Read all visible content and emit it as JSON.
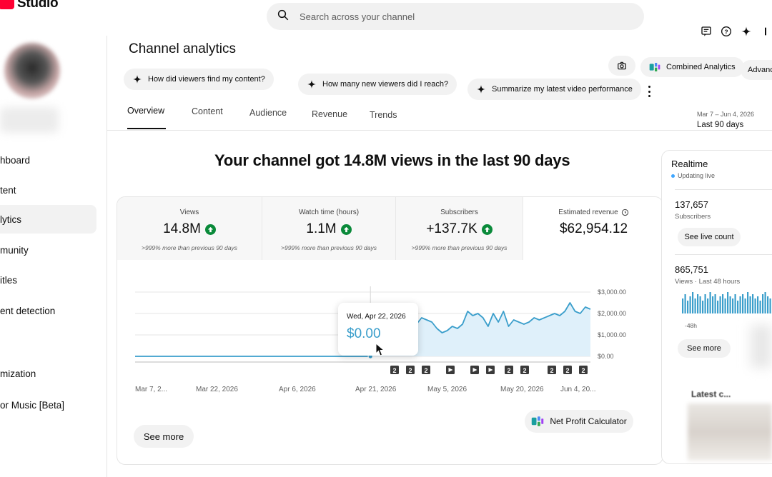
{
  "app": {
    "logo_text": "Studio"
  },
  "search": {
    "placeholder": "Search across your channel"
  },
  "sidebar": {
    "items": [
      {
        "label": "hboard"
      },
      {
        "label": "tent"
      },
      {
        "label": "lytics"
      },
      {
        "label": "munity"
      },
      {
        "label": "itles"
      },
      {
        "label": "ent detection"
      },
      {
        "label": "mization"
      },
      {
        "label": "or Music [Beta]"
      }
    ]
  },
  "header": {
    "title": "Channel analytics",
    "suggestions": [
      "How did viewers find my content?",
      "How many new viewers did I reach?",
      "Summarize my latest video performance"
    ],
    "combined_analytics": "Combined Analytics",
    "advanced": "Advanc"
  },
  "tabs": [
    "Overview",
    "Content",
    "Audience",
    "Revenue",
    "Trends"
  ],
  "date_range": {
    "range": "Mar 7 – Jun 4, 2026",
    "label": "Last 90 days"
  },
  "headline": "Your channel got 14.8M views in the last 90 days",
  "metrics": [
    {
      "label": "Views",
      "value": "14.8M",
      "sub": ">999% more than previous 90 days",
      "trend": "up"
    },
    {
      "label": "Watch time (hours)",
      "value": "1.1M",
      "sub": ">999% more than previous 90 days",
      "trend": "up"
    },
    {
      "label": "Subscribers",
      "value": "+137.7K",
      "sub": ">999% more than previous 90 days",
      "trend": "up"
    },
    {
      "label": "Estimated revenue",
      "value": "$62,954.12",
      "sub": "",
      "trend": "none"
    }
  ],
  "tooltip": {
    "date": "Wed, Apr 22, 2026",
    "value": "$0.00"
  },
  "chart_data": {
    "type": "line",
    "title": "",
    "xlabel": "",
    "ylabel": "",
    "x_tick_labels": [
      "Mar 7, 2...",
      "Mar 22, 2026",
      "Apr 6, 2026",
      "Apr 21, 2026",
      "May 5, 2026",
      "May 20, 2026",
      "Jun 4, 20..."
    ],
    "y_tick_labels": [
      "$3,000.00",
      "$2,000.00",
      "$1,000.00",
      "$0.00"
    ],
    "ylim": [
      0,
      3000
    ],
    "x_days": [
      0,
      46,
      47,
      49,
      51,
      52,
      53,
      54,
      55,
      56,
      57,
      58,
      59,
      60,
      61,
      62,
      63,
      64,
      65,
      66,
      67,
      68,
      69,
      70,
      71,
      72,
      73,
      74,
      75,
      76,
      77,
      78,
      79,
      80,
      81,
      82,
      83,
      84,
      85,
      86,
      87,
      88,
      89
    ],
    "values": [
      0,
      0,
      600,
      1100,
      1000,
      1300,
      900,
      1100,
      1500,
      1800,
      1700,
      1600,
      1300,
      1100,
      1200,
      1400,
      1300,
      1500,
      2100,
      1900,
      2000,
      1800,
      1400,
      2000,
      1600,
      2100,
      1400,
      1700,
      1600,
      1500,
      1600,
      1800,
      1700,
      1800,
      1900,
      2000,
      1900,
      2100,
      2500,
      2100,
      2000,
      2300,
      2200
    ],
    "upload_markers": [
      "2",
      "2",
      "2",
      "▶",
      "▶",
      "▶",
      "2",
      "2",
      "2",
      "2",
      "2"
    ],
    "grid": true
  },
  "buttons": {
    "see_more": "See more",
    "net_profit": "Net Profit Calculator"
  },
  "realtime": {
    "title": "Realtime",
    "status": "Updating live",
    "subscribers_value": "137,657",
    "subscribers_label": "Subscribers",
    "see_live_count": "See live count",
    "views_value": "865,751",
    "views_label": "Views · Last 48 hours",
    "axis_label": "-48h",
    "see_more": "See more",
    "bars": [
      0.7,
      0.9,
      0.6,
      0.8,
      1.0,
      0.7,
      0.9,
      0.8,
      0.6,
      0.9,
      0.7,
      1.0,
      0.8,
      0.9,
      0.6,
      0.8,
      0.9,
      0.7,
      1.0,
      0.8,
      0.7,
      0.9,
      0.6,
      0.8,
      0.9,
      0.7,
      1.0,
      0.8,
      0.9,
      0.7,
      0.8,
      0.6,
      0.9,
      1.0,
      0.8,
      0.7,
      0.9,
      0.8,
      0.6,
      0.9
    ]
  },
  "latest": {
    "title": "Latest c..."
  },
  "colors": {
    "accent": "#3a9ecb",
    "up_badge": "#0a8a3a",
    "chart_fill": "#dff0fa"
  }
}
